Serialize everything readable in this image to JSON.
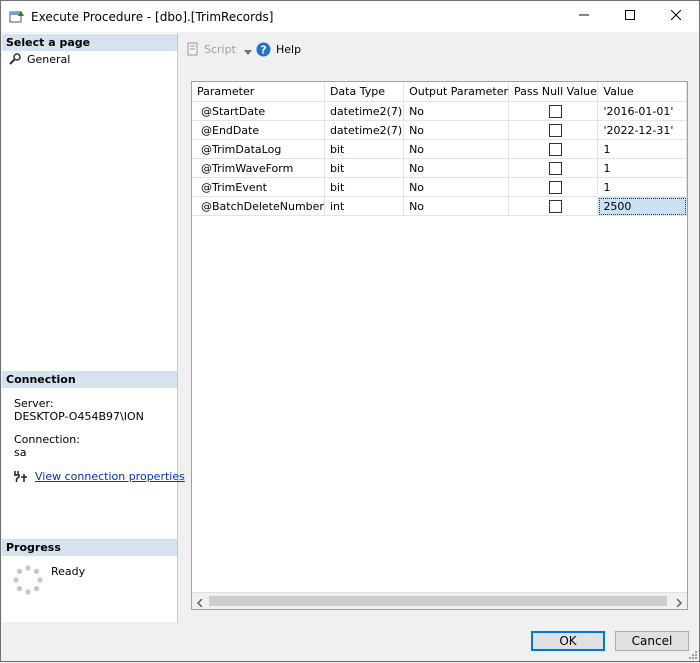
{
  "window": {
    "title": "Execute Procedure - [dbo].[TrimRecords]"
  },
  "sidebar": {
    "select_page_heading": "Select a page",
    "pages": [
      {
        "label": "General",
        "icon": "wrench-icon"
      }
    ],
    "connection_heading": "Connection",
    "server_label": "Server:",
    "server_value": "DESKTOP-O454B97\\ION",
    "connection_label": "Connection:",
    "connection_value": "sa",
    "view_props_link": "View connection properties",
    "progress_heading": "Progress",
    "progress_status": "Ready"
  },
  "toolbar": {
    "script_label": "Script",
    "help_label": "Help"
  },
  "grid": {
    "columns": [
      "Parameter",
      "Data Type",
      "Output Parameter",
      "Pass Null Value",
      "Value"
    ],
    "rows": [
      {
        "parameter": "@StartDate",
        "data_type": "datetime2(7)",
        "output": "No",
        "pass_null": false,
        "value": "'2016-01-01'"
      },
      {
        "parameter": "@EndDate",
        "data_type": "datetime2(7)",
        "output": "No",
        "pass_null": false,
        "value": "'2022-12-31'"
      },
      {
        "parameter": "@TrimDataLog",
        "data_type": "bit",
        "output": "No",
        "pass_null": false,
        "value": "1"
      },
      {
        "parameter": "@TrimWaveForm",
        "data_type": "bit",
        "output": "No",
        "pass_null": false,
        "value": "1"
      },
      {
        "parameter": "@TrimEvent",
        "data_type": "bit",
        "output": "No",
        "pass_null": false,
        "value": "1"
      },
      {
        "parameter": "@BatchDeleteNumber",
        "data_type": "int",
        "output": "No",
        "pass_null": false,
        "value": "2500"
      }
    ]
  },
  "footer": {
    "ok_label": "OK",
    "cancel_label": "Cancel"
  },
  "colors": {
    "section_header": "#d6e2ee",
    "selected_cell": "#cce0f4",
    "default_button_border": "#0078d7",
    "link": "#0033cc"
  }
}
